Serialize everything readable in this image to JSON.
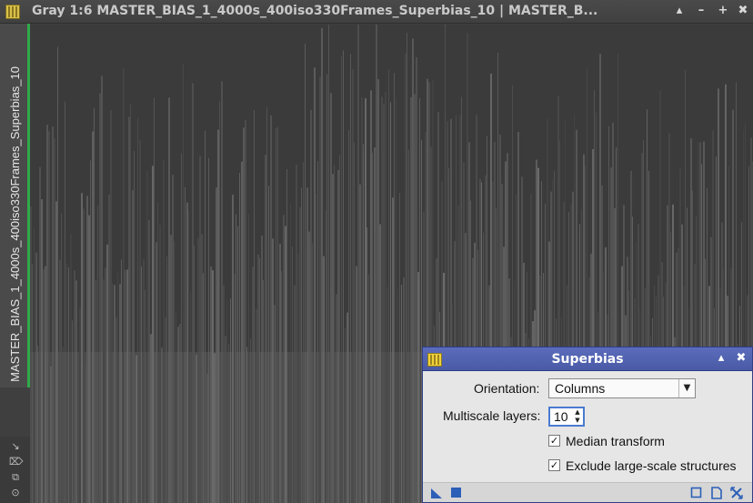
{
  "window": {
    "title": "Gray 1:6 MASTER_BIAS_1_4000s_400iso330Frames_Superbias_10 | MASTER_B...",
    "controls": {
      "shade": "▴",
      "minimize": "–",
      "maximize": "+",
      "close": "✖"
    }
  },
  "tab": {
    "label": "MASTER_BIAS_1_4000s_400iso330Frames_Superbias_10"
  },
  "side_icons": [
    "shrink-icon",
    "pin-icon",
    "clone-icon",
    "settings-icon"
  ],
  "dialog": {
    "title": "Superbias",
    "orientation_label": "Orientation:",
    "orientation_value": "Columns",
    "multiscale_label": "Multiscale layers:",
    "multiscale_value": "10",
    "median_transform_label": "Median transform",
    "median_transform_checked": true,
    "exclude_label": "Exclude large-scale structures",
    "exclude_checked": true
  },
  "colors": {
    "active_tab_accent": "#2faa4a",
    "dialog_titlebar": "#5062b2",
    "image_background": "#3b3b3b",
    "column_streaks": "#6a6a6a"
  }
}
